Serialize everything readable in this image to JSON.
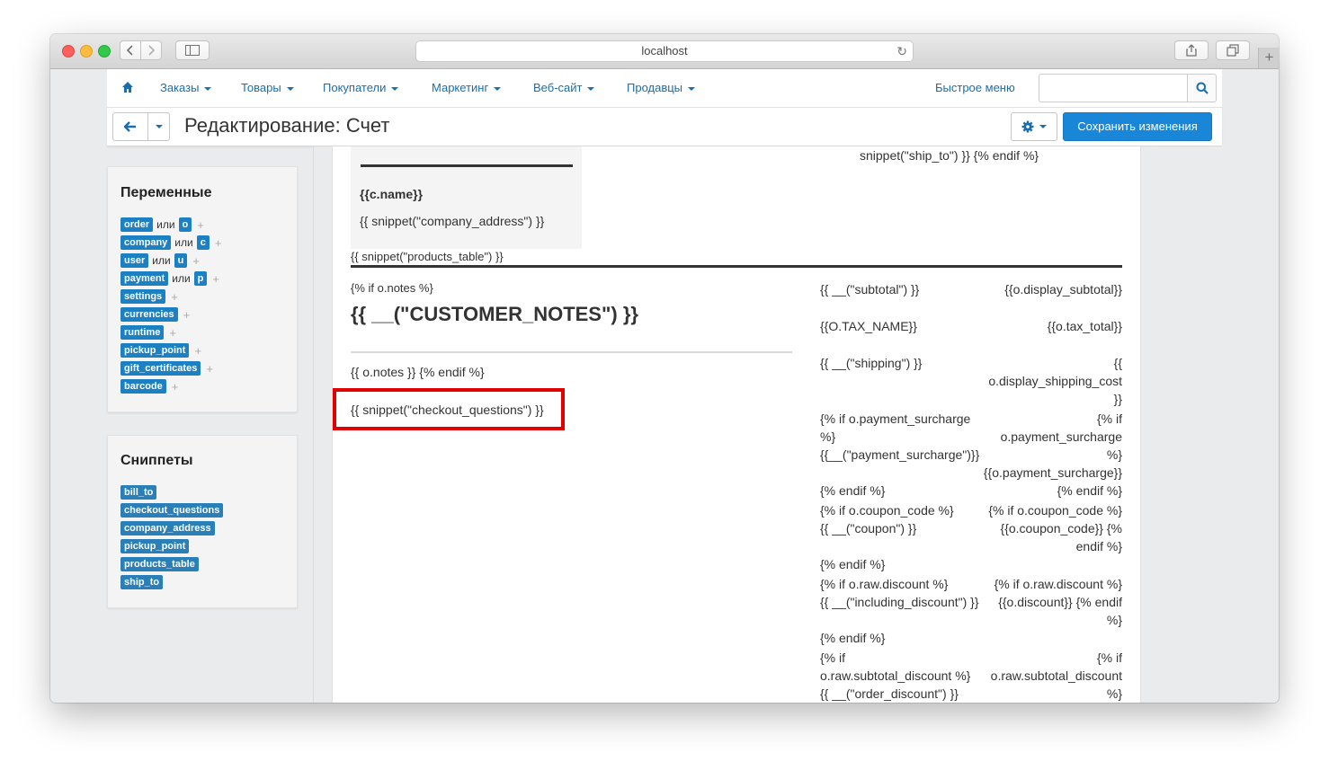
{
  "browser": {
    "url": "localhost"
  },
  "nav": {
    "items": [
      "Заказы",
      "Товары",
      "Покупатели",
      "Маркетинг",
      "Веб-сайт",
      "Продавцы"
    ],
    "quick_menu": "Быстрое меню",
    "search_placeholder": ""
  },
  "toolbar": {
    "title": "Редактирование: Счет",
    "save_label": "Сохранить изменения"
  },
  "variables": {
    "title": "Переменные",
    "or_word": "или",
    "rows": [
      {
        "name": "order",
        "alias": "o"
      },
      {
        "name": "company",
        "alias": "c"
      },
      {
        "name": "user",
        "alias": "u"
      },
      {
        "name": "payment",
        "alias": "p"
      },
      {
        "name": "settings",
        "alias": ""
      },
      {
        "name": "currencies",
        "alias": ""
      },
      {
        "name": "runtime",
        "alias": ""
      },
      {
        "name": "pickup_point",
        "alias": ""
      },
      {
        "name": "gift_certificates",
        "alias": ""
      },
      {
        "name": "barcode",
        "alias": ""
      }
    ]
  },
  "snippets": {
    "title": "Сниппеты",
    "items": [
      "bill_to",
      "checkout_questions",
      "company_address",
      "pickup_point",
      "products_table",
      "ship_to"
    ]
  },
  "doc": {
    "ship_to": "snippet(\"ship_to\") }} {% endif %}",
    "c_name": "{{c.name}}",
    "company_address": "{{ snippet(\"company_address\") }}",
    "products_table": "{{ snippet(\"products_table\") }}",
    "if_notes": "{% if o.notes %}",
    "customer_notes": "{{ __(\"CUSTOMER_NOTES\") }}",
    "notes_endif": "{{ o.notes }} {% endif %}",
    "checkout_questions": "{{ snippet(\"checkout_questions\") }}",
    "totals": {
      "subtotal_label": "{{ __(\"subtotal\") }}",
      "subtotal_value": "{{o.display_subtotal}}",
      "tax_label": "{{O.TAX_NAME}}",
      "tax_value": "{{o.tax_total}}",
      "shipping_label": "{{ __(\"shipping\") }}",
      "shipping_value_1": "{{",
      "shipping_value_2": "o.display_shipping_cost",
      "shipping_value_3": "}}",
      "surcharge_left_1": "{% if o.payment_surcharge",
      "surcharge_left_2": "%}",
      "surcharge_left_3": "{{__(\"payment_surcharge\")}}",
      "surcharge_left_4": "{% endif %}",
      "surcharge_right_1": "{% if",
      "surcharge_right_2": "o.payment_surcharge",
      "surcharge_right_3": "%}",
      "surcharge_right_4": "{{o.payment_surcharge}}",
      "surcharge_right_5": "{% endif %}",
      "coupon_left_1": "{% if o.coupon_code %}",
      "coupon_left_2": "{{ __(\"coupon\") }}",
      "coupon_left_3": "{% endif %}",
      "coupon_right_1": "{% if o.coupon_code %}",
      "coupon_right_2": "{{o.coupon_code}} {%",
      "coupon_right_3": "endif %}",
      "discount_left_1": "{% if o.raw.discount %}",
      "discount_left_2": "{{ __(\"including_discount\") }}",
      "discount_left_3": "{% endif %}",
      "discount_right_1": "{% if o.raw.discount %}",
      "discount_right_2": "{{o.discount}} {% endif",
      "discount_right_3": "%}",
      "sub_disc_left_1": "{% if",
      "sub_disc_left_2": "o.raw.subtotal_discount %}",
      "sub_disc_left_3": "{{ __(\"order_discount\") }}",
      "sub_disc_right_1": "{% if",
      "sub_disc_right_2": "o.raw.subtotal_discount",
      "sub_disc_right_3": "%}"
    }
  }
}
